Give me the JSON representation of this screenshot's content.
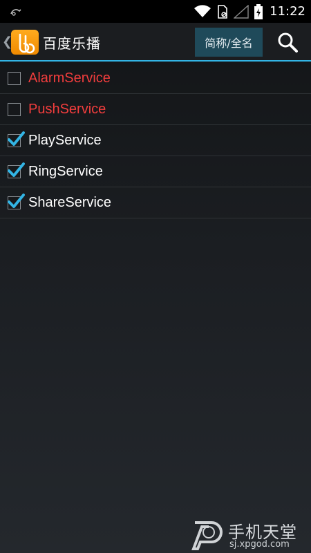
{
  "status_bar": {
    "time": "11:22",
    "icons": [
      "notification-icon",
      "wifi-icon",
      "sim-icon",
      "signal-icon",
      "battery-charging-icon"
    ]
  },
  "action_bar": {
    "back_glyph": "❮",
    "title": "百度乐播",
    "toggle_label": "简称/全名",
    "app_icon": "baidu-lebo-logo-icon",
    "search_icon": "search-icon"
  },
  "services": [
    {
      "label": "AlarmService",
      "checked": false,
      "color": "#f23d3d"
    },
    {
      "label": "PushService",
      "checked": false,
      "color": "#f23d3d"
    },
    {
      "label": "PlayService",
      "checked": true,
      "color": "#ffffff"
    },
    {
      "label": "RingService",
      "checked": true,
      "color": "#ffffff"
    },
    {
      "label": "ShareService",
      "checked": true,
      "color": "#ffffff"
    }
  ],
  "watermark": {
    "title": "手机天堂",
    "url": "sj.xpgod.com"
  },
  "colors": {
    "accent": "#33b5e5",
    "check": "#33b5e5",
    "disabled_text": "#f23d3d"
  }
}
